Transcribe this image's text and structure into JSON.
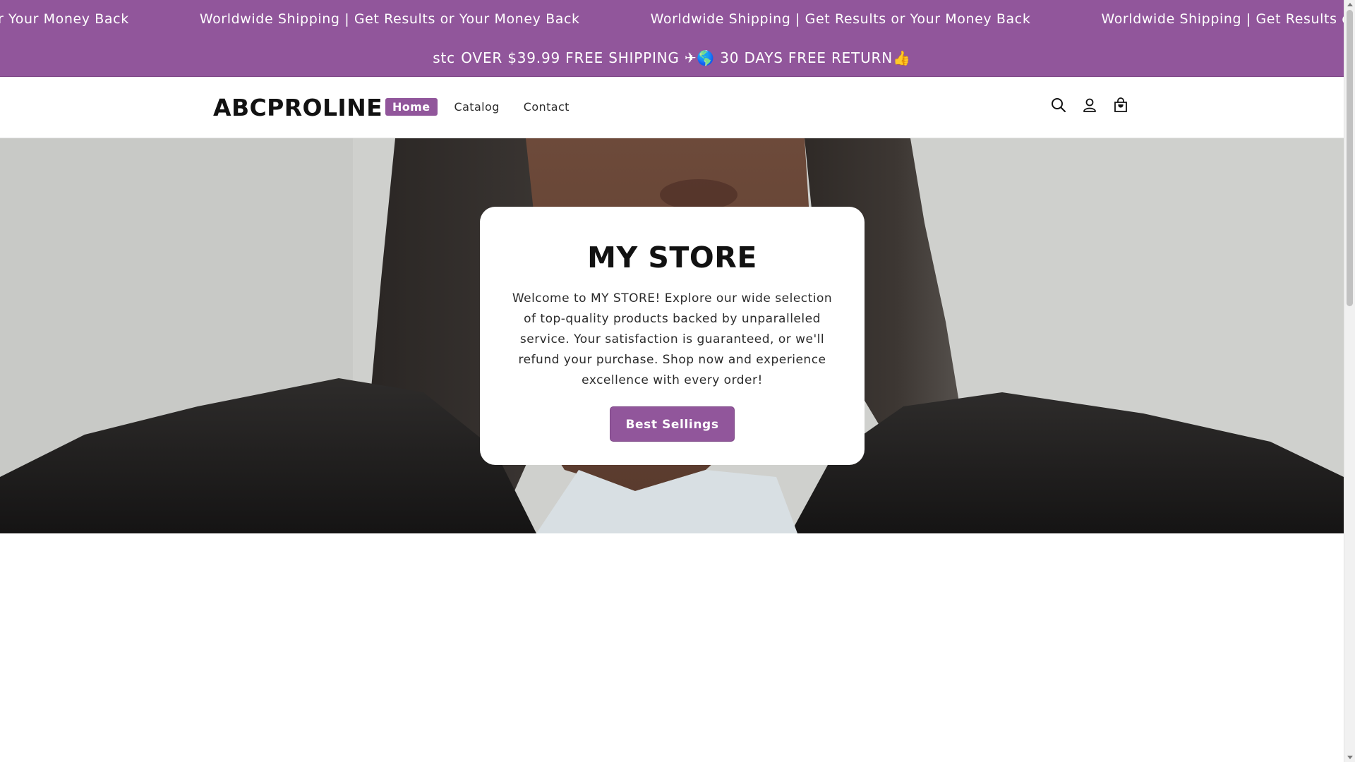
{
  "announcement": {
    "marquee_items": [
      "Worldwide Shipping | Get Results or Your Money Back",
      "Worldwide Shipping | Get Results or Your Money Back",
      "Worldwide Shipping | Get Results or Your Money Back",
      "Worldwide Shipping | Get Results or Your Money Back"
    ],
    "shipping_fragment": "stc",
    "shipping_text": "OVER $39.99 FREE SHIPPING ✈🌎 30 DAYS FREE RETURN👍",
    "bar_color": "#91569b"
  },
  "header": {
    "logo": "ABCPROLINE",
    "nav": [
      {
        "label": "Home",
        "active": true
      },
      {
        "label": "Catalog",
        "active": false
      },
      {
        "label": "Contact",
        "active": false
      }
    ],
    "icons": [
      "search-icon",
      "account-icon",
      "cart-icon"
    ]
  },
  "hero": {
    "title": "MY STORE",
    "text": "Welcome to MY STORE! Explore our wide selection of top-quality products backed by unparalleled service. Your satisfaction is guaranteed, or we'll refund your purchase. Shop now and experience excellence with every order!",
    "button_label": "Best Sellings",
    "accent": "#91569b"
  }
}
